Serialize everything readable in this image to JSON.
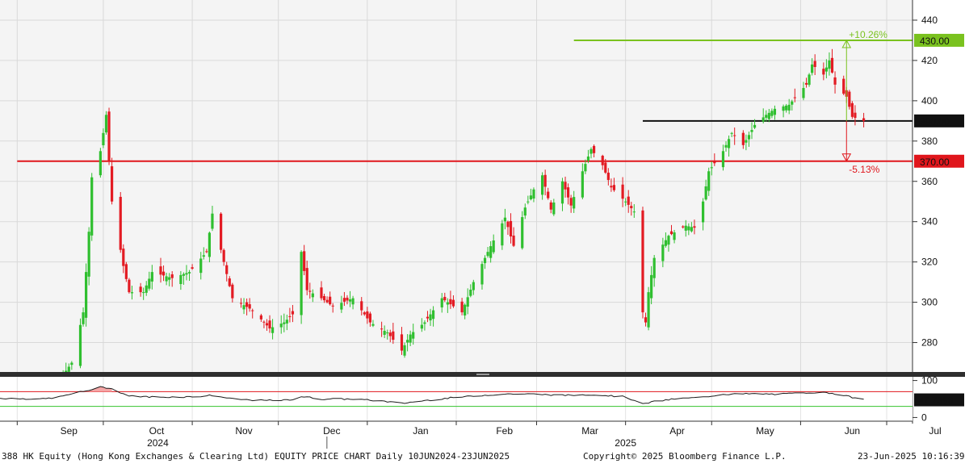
{
  "footer": {
    "left": "388 HK Equity (Hong Kong Exchanges & Clearing Ltd) EQUITY PRICE CHART  Daily 10JUN2024-23JUN2025",
    "center": "Copyright© 2025 Bloomberg Finance L.P.",
    "right": "23-Jun-2025 10:16:39"
  },
  "chart_data": [
    {
      "type": "candlestick",
      "x_range": [
        "2024-08-26",
        "2025-07-10"
      ],
      "ylim": [
        265,
        450
      ],
      "y_ticks": [
        280,
        300,
        320,
        340,
        360,
        380,
        400,
        420,
        440
      ],
      "month_labels": [
        {
          "label": "Sep",
          "date": "2024-09-01"
        },
        {
          "label": "Oct",
          "date": "2024-10-01"
        },
        {
          "label": "Nov",
          "date": "2024-11-01"
        },
        {
          "label": "Dec",
          "date": "2024-12-01"
        },
        {
          "label": "Jan",
          "date": "2025-01-01"
        },
        {
          "label": "Feb",
          "date": "2025-02-01"
        },
        {
          "label": "Mar",
          "date": "2025-03-01"
        },
        {
          "label": "Apr",
          "date": "2025-04-01"
        },
        {
          "label": "May",
          "date": "2025-05-01"
        },
        {
          "label": "Jun",
          "date": "2025-06-01"
        },
        {
          "label": "Jul",
          "date": "2025-07-01"
        }
      ],
      "year_labels": [
        {
          "label": "2024",
          "date": "2024-10-20"
        },
        {
          "label": "2025",
          "date": "2025-04-01"
        }
      ],
      "year_divider": "2025-01-01",
      "horizontal_lines": [
        {
          "value": 430.0,
          "label": "430.00",
          "color": "#7ac21f",
          "start": "2025-03-14"
        },
        {
          "value": 390.0,
          "label": "390.00",
          "color": "#111111",
          "start": "2025-04-07"
        },
        {
          "value": 370.0,
          "label": "370.00",
          "color": "#e0161c",
          "start": "2024-09-01"
        }
      ],
      "annotations": [
        {
          "label": "+10.26%",
          "color": "#7ac21f",
          "from": 390,
          "to": 430,
          "date": "2025-06-17"
        },
        {
          "label": "-5.13%",
          "color": "#e0161c",
          "from": 390,
          "to": 370,
          "date": "2025-06-17"
        }
      ],
      "anchors": [
        [
          "2024-09-16",
          262
        ],
        [
          "2024-09-20",
          270
        ],
        [
          "2024-09-24",
          295
        ],
        [
          "2024-09-25",
          315
        ],
        [
          "2024-09-26",
          335
        ],
        [
          "2024-09-27",
          362
        ],
        [
          "2024-09-30",
          375
        ],
        [
          "2024-10-02",
          393
        ],
        [
          "2024-10-03",
          370
        ],
        [
          "2024-10-04",
          350
        ],
        [
          "2024-10-08",
          318
        ],
        [
          "2024-10-10",
          305
        ],
        [
          "2024-10-15",
          305
        ],
        [
          "2024-10-18",
          315
        ],
        [
          "2024-10-25",
          312
        ],
        [
          "2024-10-31",
          315
        ],
        [
          "2024-11-06",
          325
        ],
        [
          "2024-11-08",
          344
        ],
        [
          "2024-11-12",
          320
        ],
        [
          "2024-11-15",
          302
        ],
        [
          "2024-11-22",
          296
        ],
        [
          "2024-11-28",
          287
        ],
        [
          "2024-12-03",
          290
        ],
        [
          "2024-12-06",
          294
        ],
        [
          "2024-12-09",
          325
        ],
        [
          "2024-12-11",
          306
        ],
        [
          "2024-12-16",
          302
        ],
        [
          "2024-12-20",
          298
        ],
        [
          "2024-12-27",
          302
        ],
        [
          "2025-01-02",
          290
        ],
        [
          "2025-01-08",
          285
        ],
        [
          "2025-01-13",
          276
        ],
        [
          "2025-01-16",
          284
        ],
        [
          "2025-01-21",
          290
        ],
        [
          "2025-01-27",
          302
        ],
        [
          "2025-02-03",
          295
        ],
        [
          "2025-02-07",
          310
        ],
        [
          "2025-02-12",
          325
        ],
        [
          "2025-02-18",
          342
        ],
        [
          "2025-02-21",
          328
        ],
        [
          "2025-02-25",
          347
        ],
        [
          "2025-02-28",
          356
        ],
        [
          "2025-03-03",
          363
        ],
        [
          "2025-03-06",
          346
        ],
        [
          "2025-03-10",
          360
        ],
        [
          "2025-03-13",
          348
        ],
        [
          "2025-03-17",
          365
        ],
        [
          "2025-03-20",
          376
        ],
        [
          "2025-03-24",
          368
        ],
        [
          "2025-03-27",
          357
        ],
        [
          "2025-04-01",
          350
        ],
        [
          "2025-04-04",
          345
        ],
        [
          "2025-04-07",
          295
        ],
        [
          "2025-04-08",
          290
        ],
        [
          "2025-04-09",
          305
        ],
        [
          "2025-04-11",
          322
        ],
        [
          "2025-04-16",
          333
        ],
        [
          "2025-04-22",
          338
        ],
        [
          "2025-04-25",
          337
        ],
        [
          "2025-04-28",
          350
        ],
        [
          "2025-04-30",
          365
        ],
        [
          "2025-05-05",
          375
        ],
        [
          "2025-05-08",
          384
        ],
        [
          "2025-05-12",
          378
        ],
        [
          "2025-05-16",
          388
        ],
        [
          "2025-05-20",
          393
        ],
        [
          "2025-05-23",
          396
        ],
        [
          "2025-05-28",
          398
        ],
        [
          "2025-06-03",
          408
        ],
        [
          "2025-06-05",
          418
        ],
        [
          "2025-06-09",
          413
        ],
        [
          "2025-06-11",
          420
        ],
        [
          "2025-06-13",
          408
        ],
        [
          "2025-06-17",
          402
        ],
        [
          "2025-06-19",
          392
        ],
        [
          "2025-06-23",
          390
        ]
      ]
    },
    {
      "type": "line",
      "ylim": [
        -10,
        110
      ],
      "y_ticks": [
        0,
        100
      ],
      "reference_lines": [
        {
          "value": 70,
          "color": "#e0161c"
        },
        {
          "value": 30,
          "color": "#35c22e"
        }
      ],
      "last_value": "47.7398",
      "anchors": [
        [
          "2024-08-26",
          52
        ],
        [
          "2024-09-10",
          50
        ],
        [
          "2024-09-16",
          56
        ],
        [
          "2024-09-20",
          64
        ],
        [
          "2024-09-25",
          72
        ],
        [
          "2024-09-30",
          82
        ],
        [
          "2024-10-03",
          80
        ],
        [
          "2024-10-07",
          68
        ],
        [
          "2024-10-10",
          58
        ],
        [
          "2024-10-20",
          55
        ],
        [
          "2024-11-01",
          56
        ],
        [
          "2024-11-08",
          60
        ],
        [
          "2024-11-15",
          50
        ],
        [
          "2024-11-25",
          46
        ],
        [
          "2024-12-05",
          47
        ],
        [
          "2024-12-09",
          57
        ],
        [
          "2024-12-16",
          50
        ],
        [
          "2024-12-27",
          50
        ],
        [
          "2025-01-07",
          44
        ],
        [
          "2025-01-13",
          38
        ],
        [
          "2025-01-20",
          45
        ],
        [
          "2025-01-30",
          53
        ],
        [
          "2025-02-10",
          60
        ],
        [
          "2025-02-20",
          64
        ],
        [
          "2025-03-01",
          63
        ],
        [
          "2025-03-10",
          60
        ],
        [
          "2025-03-20",
          62
        ],
        [
          "2025-04-01",
          56
        ],
        [
          "2025-04-07",
          36
        ],
        [
          "2025-04-10",
          42
        ],
        [
          "2025-04-18",
          50
        ],
        [
          "2025-04-28",
          55
        ],
        [
          "2025-05-05",
          63
        ],
        [
          "2025-05-15",
          64
        ],
        [
          "2025-05-25",
          63
        ],
        [
          "2025-06-05",
          68
        ],
        [
          "2025-06-12",
          66
        ],
        [
          "2025-06-17",
          58
        ],
        [
          "2025-06-23",
          47.7
        ]
      ]
    }
  ]
}
